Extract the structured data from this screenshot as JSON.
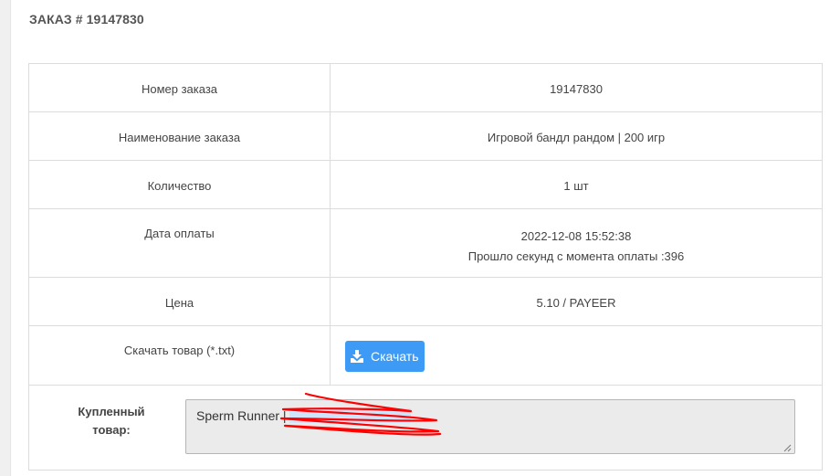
{
  "page": {
    "title": "ЗАКАЗ # 19147830"
  },
  "order": {
    "rows": [
      {
        "label": "Номер заказа",
        "value": "19147830"
      },
      {
        "label": "Наименование заказа",
        "value": "Игровой бандл рандом | 200 игр"
      },
      {
        "label": "Количество",
        "value": "1 шт"
      }
    ],
    "payment_date": {
      "label": "Дата оплаты",
      "value": "2022-12-08 15:52:38",
      "elapsed": "Прошло секунд с момента оплаты :396"
    },
    "price": {
      "label": "Цена",
      "value": "5.10 / PAYEER"
    },
    "download": {
      "label": "Скачать товар (*.txt)",
      "button_label": "Скачать",
      "icon": "download-icon"
    },
    "purchased": {
      "label_line1": "Купленный",
      "label_line2": "товар:",
      "value": "Sperm Runner | "
    }
  },
  "colors": {
    "accent": "#3d9bf5",
    "redaction": "#ff0000",
    "field_bg": "#ebebeb"
  }
}
